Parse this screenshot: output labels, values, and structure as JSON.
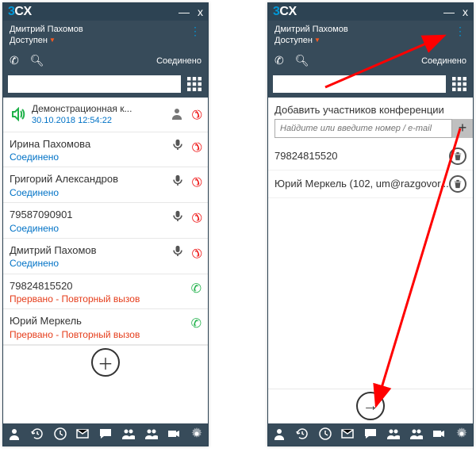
{
  "brand": {
    "three": "3",
    "cx": "CX"
  },
  "titlebar": {
    "minimize": "—",
    "close": "x"
  },
  "user": {
    "name": "Дмитрий Пахомов",
    "status": "Доступен"
  },
  "actionbar": {
    "connected_label": "Соединено"
  },
  "left": {
    "conference": {
      "title": "Демонстрационная к...",
      "date": "30.10.2018",
      "time": "12:54:22"
    },
    "participants": [
      {
        "name": "Ирина Пахомова",
        "status_key": "ok",
        "status": "Соединено",
        "has_mic": true,
        "has_hangup": true,
        "has_call": false
      },
      {
        "name": "Григорий Александров",
        "status_key": "ok",
        "status": "Соединено",
        "has_mic": true,
        "has_hangup": true,
        "has_call": false
      },
      {
        "name": "79587090901",
        "status_key": "ok",
        "status": "Соединено",
        "has_mic": true,
        "has_hangup": true,
        "has_call": false
      },
      {
        "name": "Дмитрий Пахомов",
        "status_key": "ok",
        "status": "Соединено",
        "has_mic": true,
        "has_hangup": true,
        "has_call": false
      },
      {
        "name": "79824815520",
        "status_key": "err",
        "status": "Прервано - Повторный вызов",
        "has_mic": false,
        "has_hangup": false,
        "has_call": true
      },
      {
        "name": "Юрий Меркель",
        "status_key": "err",
        "status": "Прервано - Повторный вызов",
        "has_mic": false,
        "has_hangup": false,
        "has_call": true
      }
    ]
  },
  "right": {
    "heading": "Добавить участников конференции",
    "input_placeholder": "Найдите или введите номер / e-mail",
    "selected": [
      {
        "label": "79824815520"
      },
      {
        "label": "Юрий Меркель (102, um@razgovor..."
      }
    ]
  },
  "footer_icons": [
    "presence",
    "history",
    "clock",
    "voicemail",
    "chat",
    "contacts",
    "conference",
    "video",
    "settings"
  ]
}
